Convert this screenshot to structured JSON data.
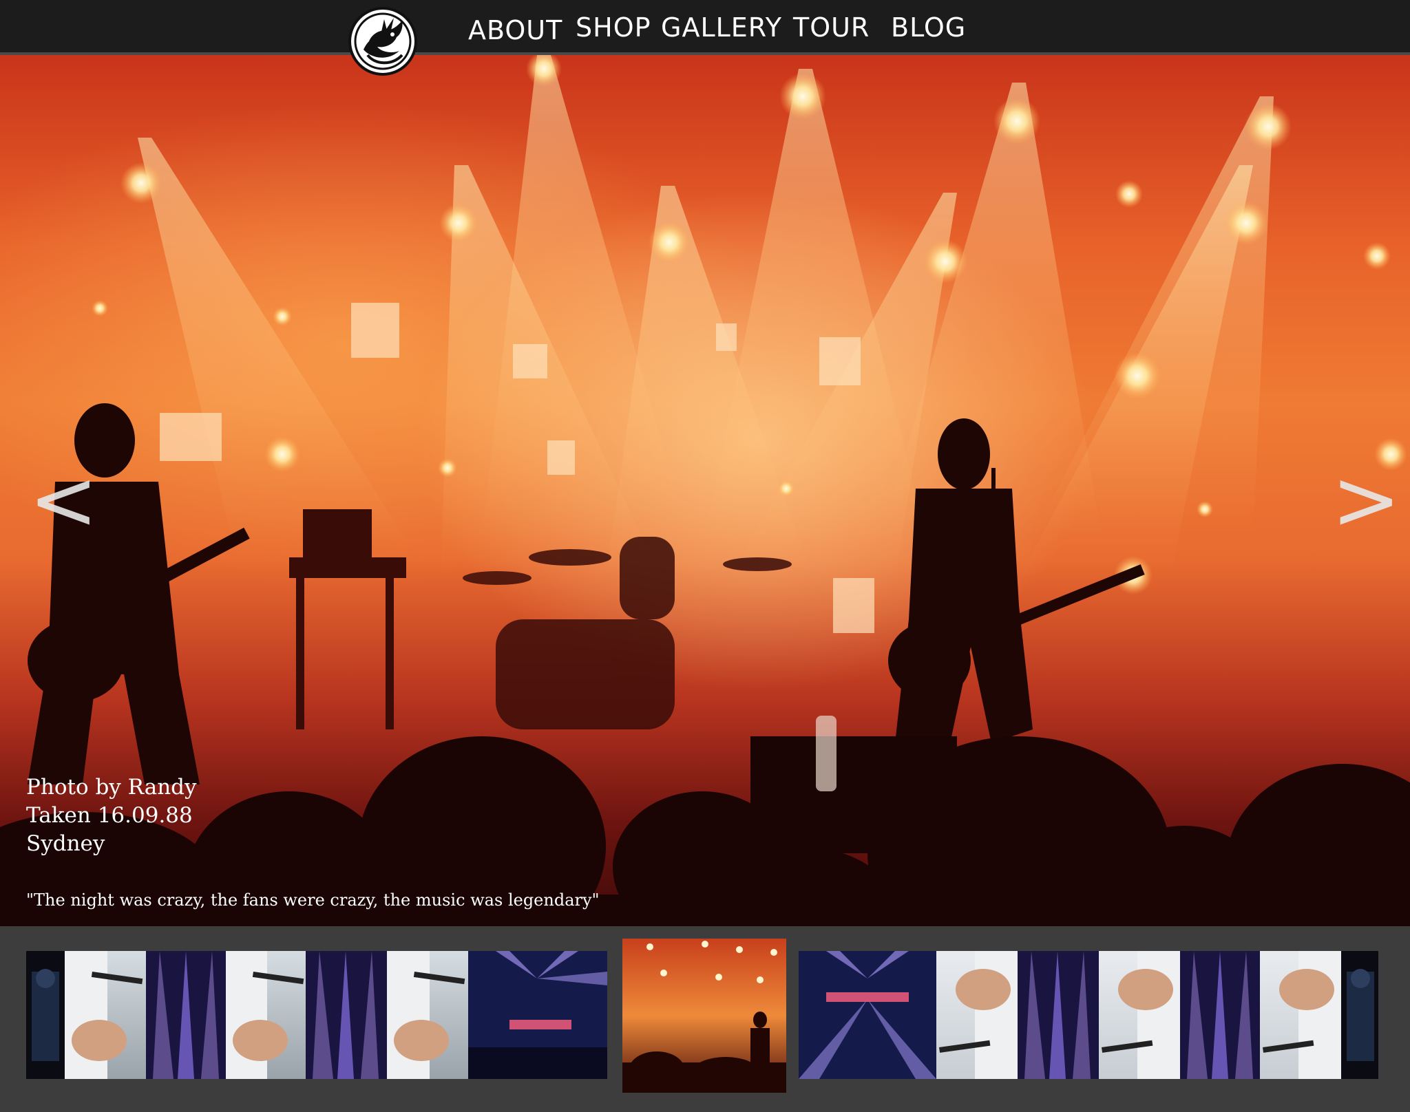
{
  "nav": {
    "logo_icon": "dragon-logo-icon",
    "items": [
      {
        "label": "ABOUT"
      },
      {
        "label": "SHOP"
      },
      {
        "label": "GALLERY"
      },
      {
        "label": "TOUR"
      },
      {
        "label": "BLOG"
      }
    ]
  },
  "hero": {
    "caption": {
      "photographer": "Photo by Randy",
      "date": "Taken 16.09.88",
      "location": "Sydney"
    },
    "quote": "\"The night was crazy, the fans were crazy, the music was legendary\"",
    "prev_icon": "<",
    "next_icon": ">"
  },
  "thumbnails": {
    "selected_index": 7,
    "items": [
      {
        "kind": "dark-performer"
      },
      {
        "kind": "microphone-hand"
      },
      {
        "kind": "purple-stage-lights"
      },
      {
        "kind": "microphone-hand"
      },
      {
        "kind": "purple-stage-lights"
      },
      {
        "kind": "microphone-hand"
      },
      {
        "kind": "blue-stage-lights"
      },
      {
        "kind": "orange-concert"
      },
      {
        "kind": "blue-stage-lights"
      },
      {
        "kind": "microphone-hand"
      },
      {
        "kind": "purple-stage-lights"
      },
      {
        "kind": "microphone-hand"
      },
      {
        "kind": "purple-stage-lights"
      },
      {
        "kind": "microphone-hand"
      },
      {
        "kind": "dark-performer"
      }
    ]
  },
  "colors": {
    "nav_background": "#1c1c1c",
    "strip_background": "#3d3d3d",
    "hero_accent": "#e8622a"
  }
}
